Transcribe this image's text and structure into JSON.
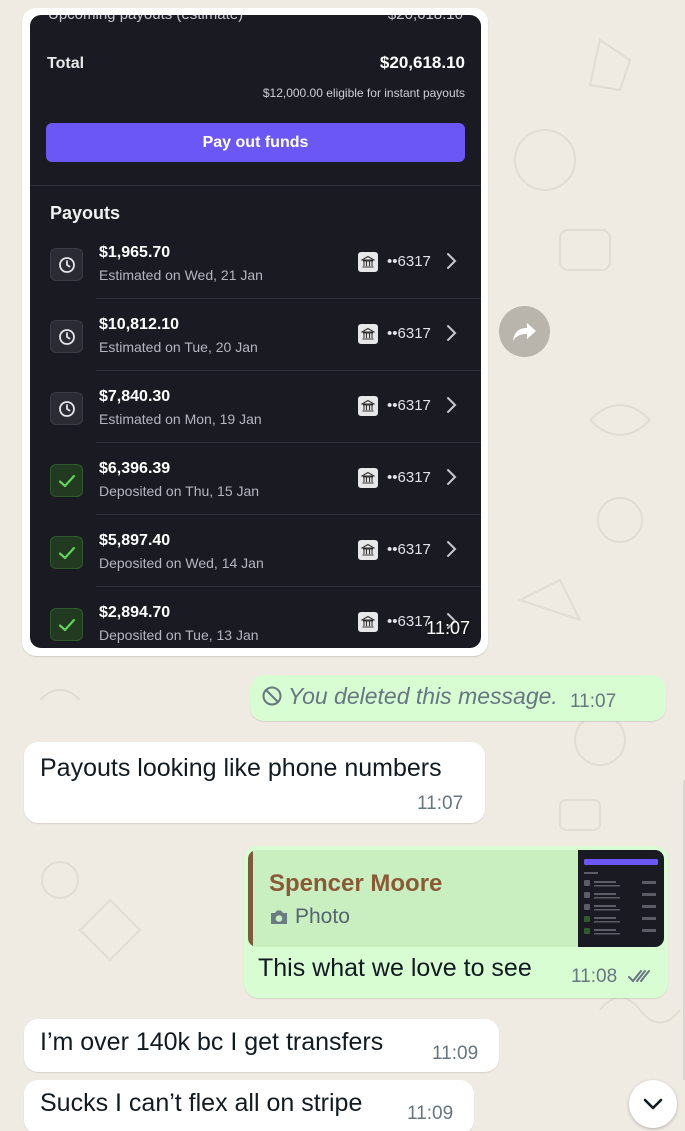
{
  "screenshot": {
    "top_cut_left": "Upcoming payouts (estimate)",
    "top_cut_right": "$20,618.10",
    "total_label": "Total",
    "total_amount": "$20,618.10",
    "eligible_text": "$12,000.00 eligible for instant payouts",
    "payout_button": "Pay out funds",
    "payouts_title": "Payouts",
    "payouts": [
      {
        "amount": "$1,965.70",
        "date": "Estimated on Wed, 21 Jan",
        "account": "••6317",
        "status": "clock-icon"
      },
      {
        "amount": "$10,812.10",
        "date": "Estimated on Tue, 20 Jan",
        "account": "••6317",
        "status": "clock-icon"
      },
      {
        "amount": "$7,840.30",
        "date": "Estimated on Mon, 19 Jan",
        "account": "••6317",
        "status": "clock-icon"
      },
      {
        "amount": "$6,396.39",
        "date": "Deposited on Thu, 15 Jan",
        "account": "••6317",
        "status": "check-icon"
      },
      {
        "amount": "$5,897.40",
        "date": "Deposited on Wed, 14 Jan",
        "account": "••6317",
        "status": "check-icon"
      },
      {
        "amount": "$2,894.70",
        "date": "Deposited on Tue, 13 Jan",
        "account": "••6317",
        "status": "check-icon"
      }
    ],
    "accent_color": "#6b57f5",
    "time": "11:07"
  },
  "messages": {
    "deleted": {
      "text": "You deleted this message.",
      "time": "11:07"
    },
    "phone": {
      "text": "Payouts looking like phone numbers",
      "time": "11:07"
    },
    "reply": {
      "quoted_name": "Spencer Moore",
      "quoted_type": "Photo",
      "text": "This what we love to see",
      "time": "11:08",
      "status": "double-check-icon"
    },
    "over": {
      "text": "I’m over 140k bc I get transfers",
      "time": "11:09"
    },
    "sucks": {
      "text": "Sucks I can’t flex all on stripe",
      "time": "11:09"
    }
  },
  "colors": {
    "chat_background": "#efeae2",
    "outgoing_bubble": "#d9fdd3",
    "incoming_bubble": "#ffffff",
    "screenshot_bg": "#1a1b22"
  }
}
